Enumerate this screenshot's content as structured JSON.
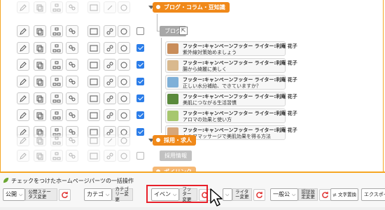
{
  "categories": {
    "blog": "ブログ・コラム・豆知識",
    "blog_sub": "ブログ",
    "recruit": "採用・求人",
    "recruit_sub": "採用情報",
    "partial": "ポイリンク"
  },
  "entries": [
    {
      "line1": "フッター:キャンペーンフッター ライター:利庵 花子",
      "line2": "紫外線対策始めましょう"
    },
    {
      "line1": "フッター:キャンペーンフッター ライター:利庵 花子",
      "line2": "腸から綺麗に美しく"
    },
    {
      "line1": "フッター:キャンペーンフッター ライター:利庵 花子",
      "line2": "正しい水分補給、できていますか？"
    },
    {
      "line1": "フッター:キャンペーンフッター ライター:利庵 花子",
      "line2": "美肌につながる生活習慣"
    },
    {
      "line1": "フッター:キャンペーンフッター ライター:利庵 花子",
      "line2": "アロマの効果と使い方"
    },
    {
      "line1": "フッター:キャンペーンフッター ライター:利庵 花子",
      "line2": "セルフマッサージで美肌効果を得る方法"
    }
  ],
  "bulk": {
    "title": "チェックをつけたホームページパーツの一括操作",
    "status_value": "公開",
    "status_label": "公開ステータス変更",
    "category_value": "カテゴ",
    "category_label": "カテゴリー変更",
    "footer_value": "イベン",
    "footer_label": "フッター変更",
    "writer_label": "ライター変更",
    "auth_value": "一般公",
    "auth_label": "認証設定変更",
    "replace_label": "文字置換",
    "export_label": "エクスポート"
  },
  "colors": {
    "accent": "#f0891a",
    "frame": "#f5a623",
    "check": "#2b7de9",
    "highlight": "#e8202a"
  }
}
